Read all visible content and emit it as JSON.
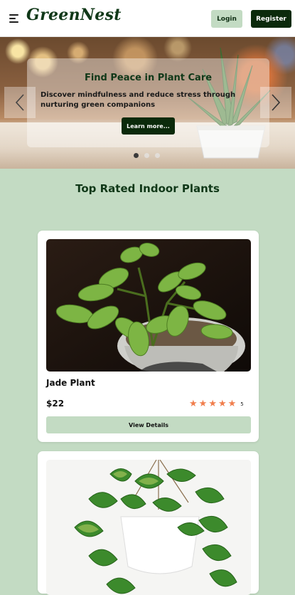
{
  "navbar": {
    "brand": "GreenNest",
    "login_label": "Login",
    "register_label": "Register"
  },
  "hero": {
    "title": "Find Peace in Plant Care",
    "text": "Discover mindfulness and reduce stress through nurturing green companions",
    "cta_label": "Learn more...",
    "slides": 3,
    "active_slide": 1
  },
  "section": {
    "title": "Top Rated Indoor Plants"
  },
  "plants": [
    {
      "name": "Jade Plant",
      "price": "$22",
      "rating": 5,
      "rating_label": "5",
      "button_label": "View Details"
    }
  ],
  "colors": {
    "brand": "#103818",
    "accent_light": "#c3dbc3",
    "dark_button": "#0b2a0b",
    "star": "#f07d4c"
  },
  "icons": {
    "menu": "hamburger-icon",
    "prev": "chevron-left-icon",
    "next": "chevron-right-icon",
    "star": "star-icon"
  }
}
